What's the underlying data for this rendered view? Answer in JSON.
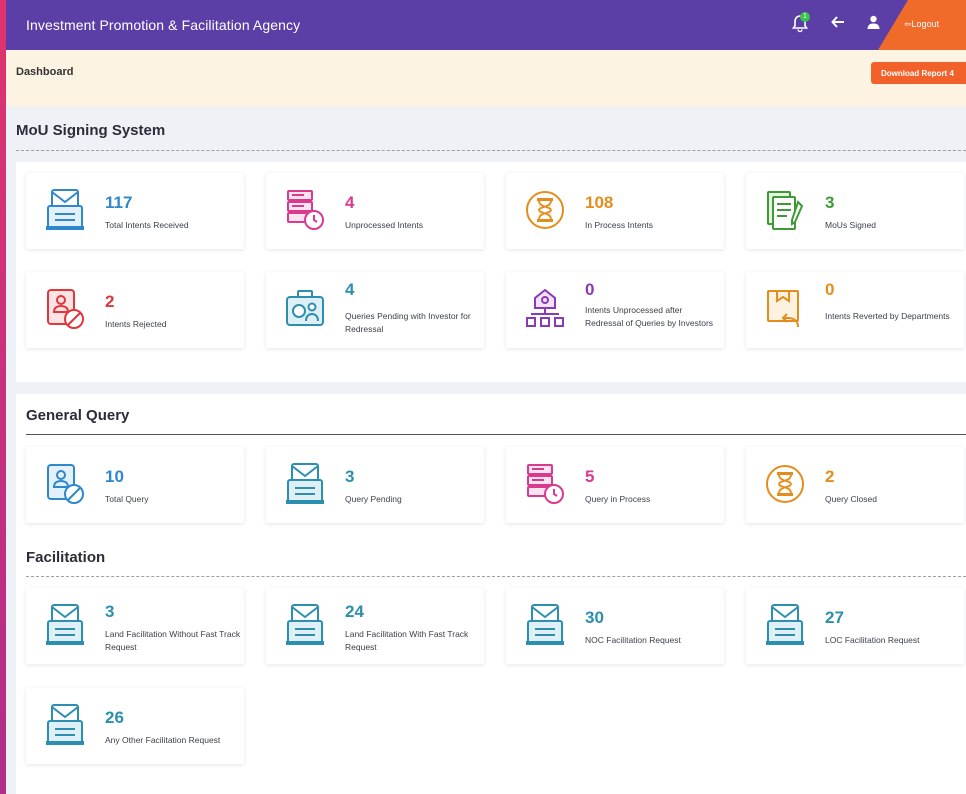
{
  "header": {
    "title": "Investment Promotion & Facilitation Agency",
    "notification_count": "1",
    "logout_label": "Logout"
  },
  "breadcrumb": {
    "label": "Dashboard",
    "download_label": "Download Report 4"
  },
  "mou": {
    "heading": "MoU Signing System",
    "cards": [
      {
        "value": "117",
        "label": "Total Intents Received",
        "color": "#2e88c9",
        "icon": "document-stand-icon"
      },
      {
        "value": "4",
        "label": "Unprocessed Intents",
        "color": "#d93a8e",
        "icon": "server-clock-icon"
      },
      {
        "value": "108",
        "label": "In Process Intents",
        "color": "#e38d1c",
        "icon": "hourglass-icon"
      },
      {
        "value": "3",
        "label": "MoUs Signed",
        "color": "#3f9a35",
        "icon": "signed-document-icon"
      },
      {
        "value": "2",
        "label": "Intents Rejected",
        "color": "#e0363c",
        "icon": "user-ban-icon"
      },
      {
        "value": "4",
        "label": "Queries Pending with Investor for Redressal",
        "color": "#2c8fb0",
        "icon": "investor-briefcase-icon"
      },
      {
        "value": "0",
        "label": "Intents Unprocessed after Redressal of Queries by Investors",
        "color": "#8a3ab5",
        "icon": "network-house-icon"
      },
      {
        "value": "0",
        "label": "Intents Reverted by Departments",
        "color": "#e38d1c",
        "icon": "revert-box-icon"
      }
    ]
  },
  "general": {
    "heading": "General Query",
    "cards": [
      {
        "value": "10",
        "label": "Total Query",
        "color": "#2e88c9",
        "icon": "user-ban-icon"
      },
      {
        "value": "3",
        "label": "Query Pending",
        "color": "#2c8fb0",
        "icon": "document-stand-icon"
      },
      {
        "value": "5",
        "label": "Query in Process",
        "color": "#d93a8e",
        "icon": "server-clock-icon"
      },
      {
        "value": "2",
        "label": "Query Closed",
        "color": "#e38d1c",
        "icon": "hourglass-icon"
      }
    ]
  },
  "facilitation": {
    "heading": "Facilitation",
    "cards": [
      {
        "value": "3",
        "label": "Land Facilitation Without Fast Track Request",
        "color": "#2c8fb0",
        "icon": "document-stand-icon"
      },
      {
        "value": "24",
        "label": "Land Facilitation With Fast Track Request",
        "color": "#2c8fb0",
        "icon": "document-stand-icon"
      },
      {
        "value": "30",
        "label": "NOC Facilitation Request",
        "color": "#2c8fb0",
        "icon": "document-stand-icon"
      },
      {
        "value": "27",
        "label": "LOC Facilitation Request",
        "color": "#2c8fb0",
        "icon": "document-stand-icon"
      },
      {
        "value": "26",
        "label": "Any Other Facilitation Request",
        "color": "#2c8fb0",
        "icon": "document-stand-icon"
      }
    ]
  }
}
